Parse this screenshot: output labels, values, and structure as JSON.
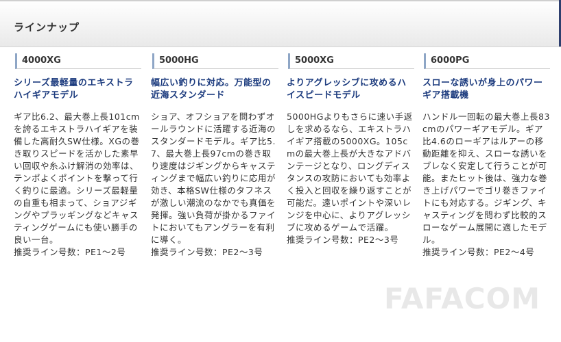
{
  "section": {
    "title": "ラインナップ"
  },
  "lineup": [
    {
      "model": "4000XG",
      "heading": "シリーズ最軽量のエキストラハイギアモデル",
      "description": "ギア比6.2、最大巻上長101cmを誇るエキストラハイギアを装備した高耐久SW仕様。XGの巻き取りスピードを活かした素早い回収や糸ふけ解消の効率は、テンポよくポイントを撃って行く釣りに最適。シリーズ最軽量の自重も相まって、ショアジギングやプラッギングなどキャスティングゲームにも使い勝手の良い一台。",
      "recommended_line": "推奨ライン号数：PE1〜2号"
    },
    {
      "model": "5000HG",
      "heading": "幅広い釣りに対応。万能型の近海スタンダード",
      "description": "ショア、オフショアを問わずオールラウンドに活躍する近海のスタンダードモデル。ギア比5.7、最大巻上長97cmの巻き取り速度はジギングからキャスティングまで幅広い釣りに応用が効き、本格SW仕様のタフネスが激しい潮流のなかでも真価を発揮。強い負荷が掛かるファイトにおいてもアングラーを有利に導く。",
      "recommended_line": "推奨ライン号数：PE2〜3号"
    },
    {
      "model": "5000XG",
      "heading": "よりアグレッシブに攻めるハイスピードモデル",
      "description": "5000HGよりもさらに速い手返しを求めるなら、エキストラハイギア搭載の5000XG。105cmの最大巻上長が大きなアドバンテージとなり、ロングディスタンスの攻防においても効率よく投入と回収を繰り返すことが可能だ。遠いポイントや深いレンジを中心に、よりアグレッシブに攻めるゲームで活躍。",
      "recommended_line": "推奨ライン号数：PE2〜3号"
    },
    {
      "model": "6000PG",
      "heading": "スローな誘いが身上のパワーギア搭載機",
      "description": "ハンドル一回転の最大巻上長83cmのパワーギアモデル。ギア比4.6のローギアはルアーの移動距離を抑え、スローな誘いをブレなく安定して行うことが可能。またヒット後は、強力な巻き上げパワーでゴリ巻きファイトにも対応する。ジギング、キャスティングを問わず比較的スローなゲーム展開に適したモデル。",
      "recommended_line": "推奨ライン号数：PE2〜4号"
    }
  ],
  "watermark": "FAFACOM"
}
